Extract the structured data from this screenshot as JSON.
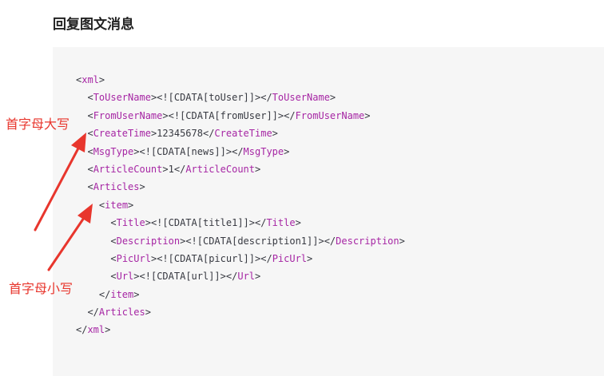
{
  "heading": "回复图文消息",
  "code_lines": [
    {
      "indent": "",
      "open": "xml",
      "value": "",
      "close": "",
      "kind": "open"
    },
    {
      "indent": "  ",
      "open": "ToUserName",
      "value": "<![CDATA[toUser]]>",
      "close": "ToUserName",
      "kind": "full"
    },
    {
      "indent": "  ",
      "open": "FromUserName",
      "value": "<![CDATA[fromUser]]>",
      "close": "FromUserName",
      "kind": "full"
    },
    {
      "indent": "  ",
      "open": "CreateTime",
      "value": "12345678",
      "close": "CreateTime",
      "kind": "full"
    },
    {
      "indent": "  ",
      "open": "MsgType",
      "value": "<![CDATA[news]]>",
      "close": "MsgType",
      "kind": "full"
    },
    {
      "indent": "  ",
      "open": "ArticleCount",
      "value": "1",
      "close": "ArticleCount",
      "kind": "full"
    },
    {
      "indent": "  ",
      "open": "Articles",
      "value": "",
      "close": "",
      "kind": "open"
    },
    {
      "indent": "    ",
      "open": "item",
      "value": "",
      "close": "",
      "kind": "open"
    },
    {
      "indent": "      ",
      "open": "Title",
      "value": "<![CDATA[title1]]>",
      "close": "Title",
      "kind": "full"
    },
    {
      "indent": "      ",
      "open": "Description",
      "value": "<![CDATA[description1]]>",
      "close": "Description",
      "kind": "full"
    },
    {
      "indent": "      ",
      "open": "PicUrl",
      "value": "<![CDATA[picurl]]>",
      "close": "PicUrl",
      "kind": "full"
    },
    {
      "indent": "      ",
      "open": "Url",
      "value": "<![CDATA[url]]>",
      "close": "Url",
      "kind": "full"
    },
    {
      "indent": "    ",
      "open": "",
      "value": "",
      "close": "item",
      "kind": "close"
    },
    {
      "indent": "  ",
      "open": "",
      "value": "",
      "close": "Articles",
      "kind": "close"
    },
    {
      "indent": "",
      "open": "",
      "value": "",
      "close": "xml",
      "kind": "close"
    }
  ],
  "annotations": {
    "uppercase": "首字母大写",
    "lowercase": "首字母小写"
  },
  "colors": {
    "tag": "#a626a4",
    "annotation": "#e8362d"
  }
}
